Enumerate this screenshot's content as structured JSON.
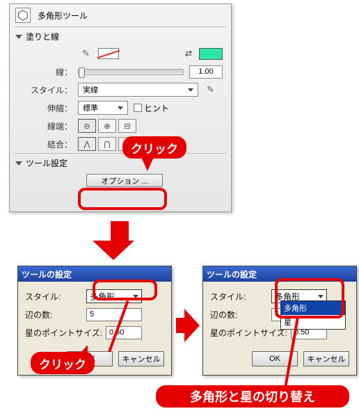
{
  "panel": {
    "title": "多角形ツール",
    "section_fillstroke": "塗りと線",
    "section_toolopts": "ツール設定",
    "labels": {
      "stroke": "線：",
      "style": "スタイル：",
      "scale": "伸縮：",
      "cap": "線端：",
      "join": "結合："
    },
    "stroke_width": "1.00",
    "style_value": "実線",
    "scale_value": "標準",
    "hint_label": "ヒント",
    "options_btn": "オプション ..."
  },
  "callouts": {
    "click": "クリック",
    "swap": "多角形と星の切り替え"
  },
  "dialog": {
    "title": "ツールの設定",
    "labels": {
      "style": "スタイル:",
      "sides": "辺の数:",
      "pointsize": "星のポイントサイズ:"
    },
    "style_value": "多角形",
    "sides_value": "5",
    "pointsize_value": "0.50",
    "ok": "OK",
    "cancel": "キャンセル",
    "options": [
      "多角形",
      "星"
    ]
  },
  "colors": {
    "accent": "#E40000",
    "fill_swatch": "#2be6a8"
  }
}
